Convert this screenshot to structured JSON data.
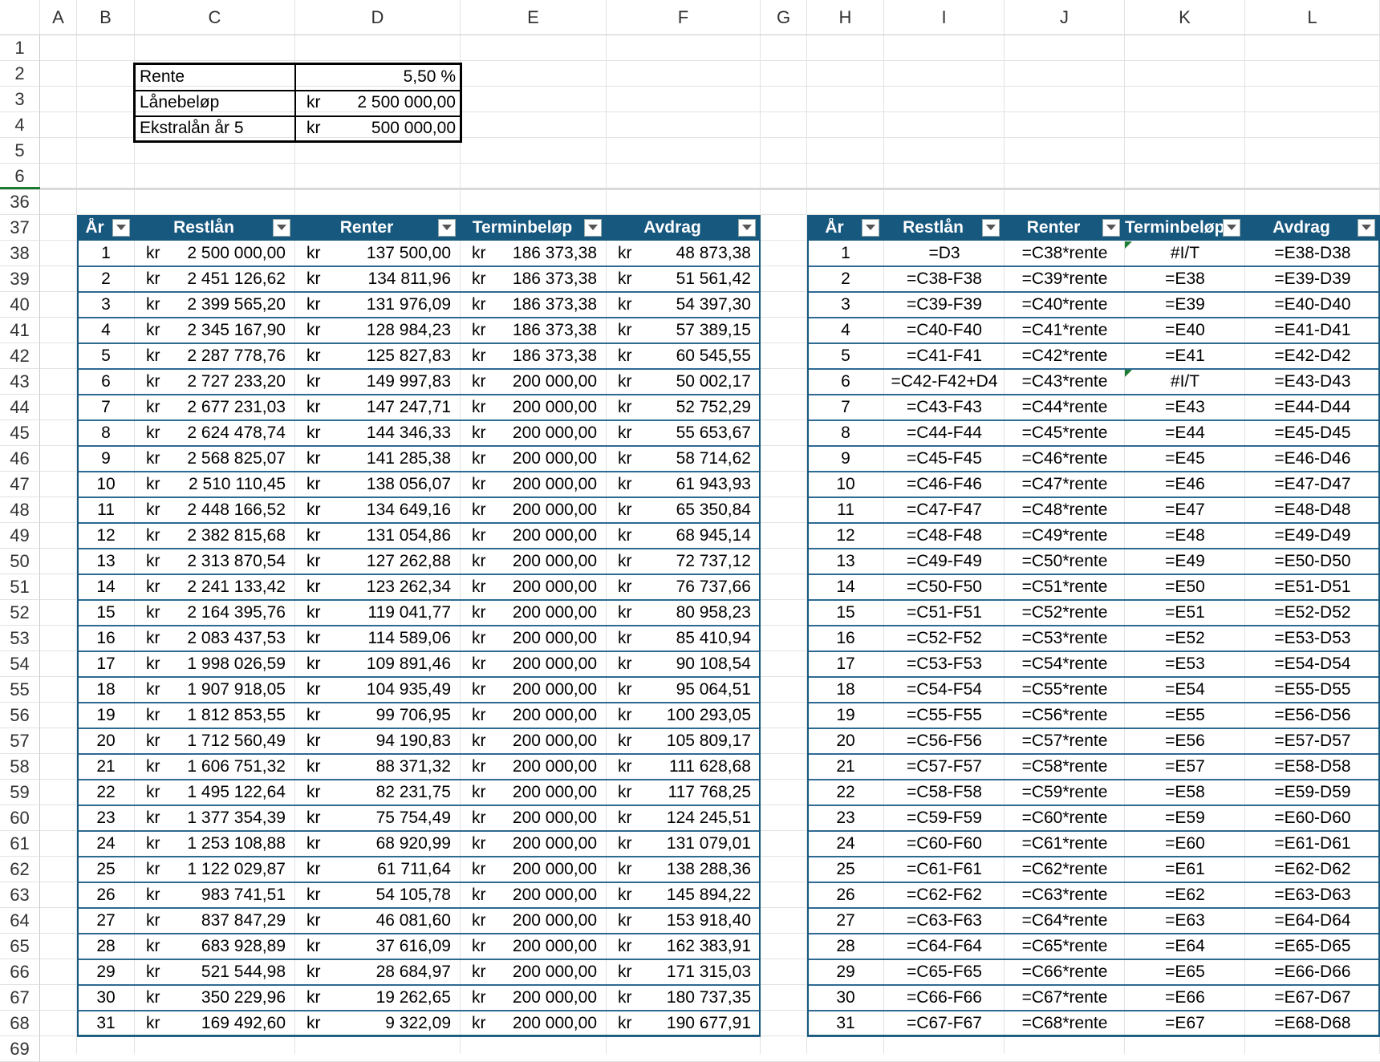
{
  "columns": [
    "A",
    "B",
    "C",
    "D",
    "E",
    "F",
    "G",
    "H",
    "I",
    "J",
    "K",
    "L"
  ],
  "row_numbers": [
    "1",
    "2",
    "3",
    "4",
    "5",
    "6",
    "36",
    "37",
    "38",
    "39",
    "40",
    "41",
    "42",
    "43",
    "44",
    "45",
    "46",
    "47",
    "48",
    "49",
    "50",
    "51",
    "52",
    "53",
    "54",
    "55",
    "56",
    "57",
    "58",
    "59",
    "60",
    "61",
    "62",
    "63",
    "64",
    "65",
    "66",
    "67",
    "68",
    "69"
  ],
  "inputs": {
    "rente_label": "Rente",
    "rente_value": "5,50 %",
    "laan_label": "Lånebeløp",
    "laan_currency": "kr",
    "laan_value": "2 500 000,00",
    "ekstra_label": "Ekstralån år 5",
    "ekstra_currency": "kr",
    "ekstra_value": "500 000,00"
  },
  "values_table": {
    "headers": [
      "År",
      "Restlån",
      "Renter",
      "Terminbeløp",
      "Avdrag"
    ],
    "currency": "kr",
    "rows": [
      [
        "1",
        "2 500 000,00",
        "137 500,00",
        "186 373,38",
        "48 873,38"
      ],
      [
        "2",
        "2 451 126,62",
        "134 811,96",
        "186 373,38",
        "51 561,42"
      ],
      [
        "3",
        "2 399 565,20",
        "131 976,09",
        "186 373,38",
        "54 397,30"
      ],
      [
        "4",
        "2 345 167,90",
        "128 984,23",
        "186 373,38",
        "57 389,15"
      ],
      [
        "5",
        "2 287 778,76",
        "125 827,83",
        "186 373,38",
        "60 545,55"
      ],
      [
        "6",
        "2 727 233,20",
        "149 997,83",
        "200 000,00",
        "50 002,17"
      ],
      [
        "7",
        "2 677 231,03",
        "147 247,71",
        "200 000,00",
        "52 752,29"
      ],
      [
        "8",
        "2 624 478,74",
        "144 346,33",
        "200 000,00",
        "55 653,67"
      ],
      [
        "9",
        "2 568 825,07",
        "141 285,38",
        "200 000,00",
        "58 714,62"
      ],
      [
        "10",
        "2 510 110,45",
        "138 056,07",
        "200 000,00",
        "61 943,93"
      ],
      [
        "11",
        "2 448 166,52",
        "134 649,16",
        "200 000,00",
        "65 350,84"
      ],
      [
        "12",
        "2 382 815,68",
        "131 054,86",
        "200 000,00",
        "68 945,14"
      ],
      [
        "13",
        "2 313 870,54",
        "127 262,88",
        "200 000,00",
        "72 737,12"
      ],
      [
        "14",
        "2 241 133,42",
        "123 262,34",
        "200 000,00",
        "76 737,66"
      ],
      [
        "15",
        "2 164 395,76",
        "119 041,77",
        "200 000,00",
        "80 958,23"
      ],
      [
        "16",
        "2 083 437,53",
        "114 589,06",
        "200 000,00",
        "85 410,94"
      ],
      [
        "17",
        "1 998 026,59",
        "109 891,46",
        "200 000,00",
        "90 108,54"
      ],
      [
        "18",
        "1 907 918,05",
        "104 935,49",
        "200 000,00",
        "95 064,51"
      ],
      [
        "19",
        "1 812 853,55",
        "99 706,95",
        "200 000,00",
        "100 293,05"
      ],
      [
        "20",
        "1 712 560,49",
        "94 190,83",
        "200 000,00",
        "105 809,17"
      ],
      [
        "21",
        "1 606 751,32",
        "88 371,32",
        "200 000,00",
        "111 628,68"
      ],
      [
        "22",
        "1 495 122,64",
        "82 231,75",
        "200 000,00",
        "117 768,25"
      ],
      [
        "23",
        "1 377 354,39",
        "75 754,49",
        "200 000,00",
        "124 245,51"
      ],
      [
        "24",
        "1 253 108,88",
        "68 920,99",
        "200 000,00",
        "131 079,01"
      ],
      [
        "25",
        "1 122 029,87",
        "61 711,64",
        "200 000,00",
        "138 288,36"
      ],
      [
        "26",
        "983 741,51",
        "54 105,78",
        "200 000,00",
        "145 894,22"
      ],
      [
        "27",
        "837 847,29",
        "46 081,60",
        "200 000,00",
        "153 918,40"
      ],
      [
        "28",
        "683 928,89",
        "37 616,09",
        "200 000,00",
        "162 383,91"
      ],
      [
        "29",
        "521 544,98",
        "28 684,97",
        "200 000,00",
        "171 315,03"
      ],
      [
        "30",
        "350 229,96",
        "19 262,65",
        "200 000,00",
        "180 737,35"
      ],
      [
        "31",
        "169 492,60",
        "9 322,09",
        "200 000,00",
        "190 677,91"
      ]
    ]
  },
  "formula_table": {
    "headers": [
      "År",
      "Restlån",
      "Renter",
      "Terminbeløp",
      "Avdrag"
    ],
    "rows": [
      [
        "1",
        "=D3",
        "=C38*rente",
        "#I/T",
        "=E38-D38"
      ],
      [
        "2",
        "=C38-F38",
        "=C39*rente",
        "=E38",
        "=E39-D39"
      ],
      [
        "3",
        "=C39-F39",
        "=C40*rente",
        "=E39",
        "=E40-D40"
      ],
      [
        "4",
        "=C40-F40",
        "=C41*rente",
        "=E40",
        "=E41-D41"
      ],
      [
        "5",
        "=C41-F41",
        "=C42*rente",
        "=E41",
        "=E42-D42"
      ],
      [
        "6",
        "=C42-F42+D4",
        "=C43*rente",
        "#I/T",
        "=E43-D43"
      ],
      [
        "7",
        "=C43-F43",
        "=C44*rente",
        "=E43",
        "=E44-D44"
      ],
      [
        "8",
        "=C44-F44",
        "=C45*rente",
        "=E44",
        "=E45-D45"
      ],
      [
        "9",
        "=C45-F45",
        "=C46*rente",
        "=E45",
        "=E46-D46"
      ],
      [
        "10",
        "=C46-F46",
        "=C47*rente",
        "=E46",
        "=E47-D47"
      ],
      [
        "11",
        "=C47-F47",
        "=C48*rente",
        "=E47",
        "=E48-D48"
      ],
      [
        "12",
        "=C48-F48",
        "=C49*rente",
        "=E48",
        "=E49-D49"
      ],
      [
        "13",
        "=C49-F49",
        "=C50*rente",
        "=E49",
        "=E50-D50"
      ],
      [
        "14",
        "=C50-F50",
        "=C51*rente",
        "=E50",
        "=E51-D51"
      ],
      [
        "15",
        "=C51-F51",
        "=C52*rente",
        "=E51",
        "=E52-D52"
      ],
      [
        "16",
        "=C52-F52",
        "=C53*rente",
        "=E52",
        "=E53-D53"
      ],
      [
        "17",
        "=C53-F53",
        "=C54*rente",
        "=E53",
        "=E54-D54"
      ],
      [
        "18",
        "=C54-F54",
        "=C55*rente",
        "=E54",
        "=E55-D55"
      ],
      [
        "19",
        "=C55-F55",
        "=C56*rente",
        "=E55",
        "=E56-D56"
      ],
      [
        "20",
        "=C56-F56",
        "=C57*rente",
        "=E56",
        "=E57-D57"
      ],
      [
        "21",
        "=C57-F57",
        "=C58*rente",
        "=E57",
        "=E58-D58"
      ],
      [
        "22",
        "=C58-F58",
        "=C59*rente",
        "=E58",
        "=E59-D59"
      ],
      [
        "23",
        "=C59-F59",
        "=C60*rente",
        "=E59",
        "=E60-D60"
      ],
      [
        "24",
        "=C60-F60",
        "=C61*rente",
        "=E60",
        "=E61-D61"
      ],
      [
        "25",
        "=C61-F61",
        "=C62*rente",
        "=E61",
        "=E62-D62"
      ],
      [
        "26",
        "=C62-F62",
        "=C63*rente",
        "=E62",
        "=E63-D63"
      ],
      [
        "27",
        "=C63-F63",
        "=C64*rente",
        "=E63",
        "=E64-D64"
      ],
      [
        "28",
        "=C64-F64",
        "=C65*rente",
        "=E64",
        "=E65-D65"
      ],
      [
        "29",
        "=C65-F65",
        "=C66*rente",
        "=E65",
        "=E66-D66"
      ],
      [
        "30",
        "=C66-F66",
        "=C67*rente",
        "=E66",
        "=E67-D67"
      ],
      [
        "31",
        "=C67-F67",
        "=C68*rente",
        "=E67",
        "=E68-D68"
      ]
    ]
  },
  "colors": {
    "header_fill": "#17587f",
    "header_text": "#ffffff",
    "table_border": "#17587f",
    "grid": "#e2e2e2",
    "error_flag": "#1e7b34"
  },
  "icons": {
    "filter_dropdown": "chevron-down-icon",
    "error_indicator": "error-flag-icon"
  }
}
